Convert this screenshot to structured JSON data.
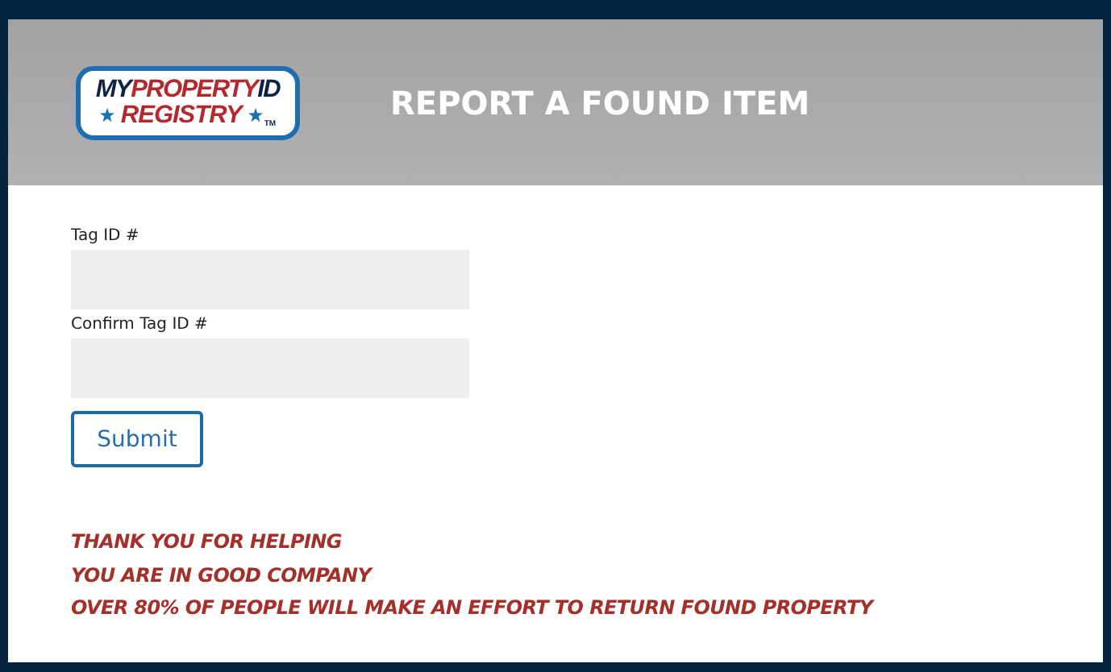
{
  "logo": {
    "line_1": [
      "MY",
      "PROPERTY",
      "ID"
    ],
    "line_2": "REGISTRY",
    "trademark": "TM"
  },
  "title": "REPORT A FOUND ITEM",
  "fields": [
    {
      "label": "Tag ID #"
    },
    {
      "label": "Confirm Tag ID #"
    }
  ],
  "submit": "Submit",
  "messages": [
    "THANK YOU FOR HELPING",
    "YOU ARE IN GOOD COMPANY",
    "OVER 80% OF PEOPLE WILL MAKE AN EFFORT TO RETURN FOUND PROPERTY"
  ]
}
